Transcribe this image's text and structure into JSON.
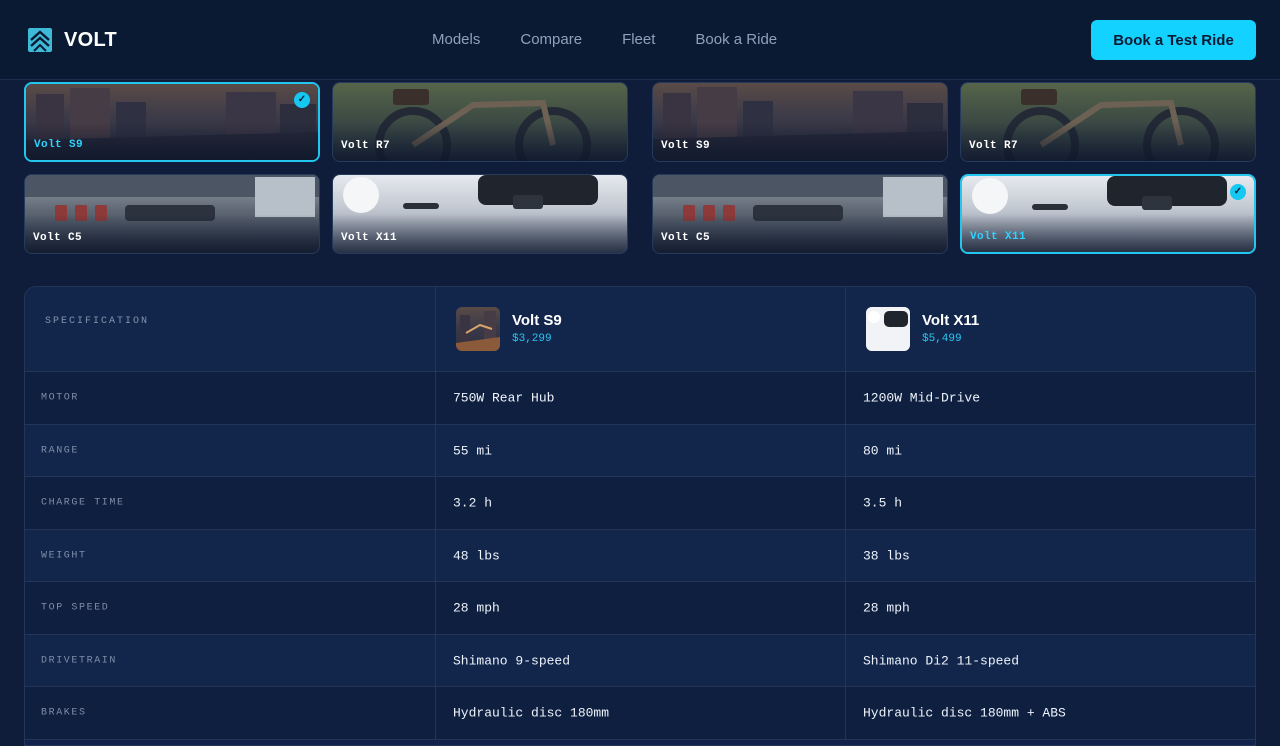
{
  "brand": {
    "name": "VOLT",
    "logo_icon": "chevron-up-logo-icon"
  },
  "nav": {
    "items": [
      "Models",
      "Compare",
      "Fleet",
      "Book a Ride"
    ]
  },
  "cta": {
    "label": "Book a Test Ride"
  },
  "colors": {
    "accent": "#14d2ff",
    "background": "#0f1d3a",
    "header": "#0b1a33"
  },
  "selector_groups": [
    {
      "thumbs": [
        {
          "label": "Volt S9",
          "art": "city",
          "selected": true
        },
        {
          "label": "Volt R7",
          "art": "bike",
          "selected": false
        },
        {
          "label": "Volt C5",
          "art": "dash",
          "selected": false
        },
        {
          "label": "Volt X11",
          "art": "snow",
          "selected": false
        }
      ]
    },
    {
      "thumbs": [
        {
          "label": "Volt S9",
          "art": "city",
          "selected": false
        },
        {
          "label": "Volt R7",
          "art": "bike",
          "selected": false
        },
        {
          "label": "Volt C5",
          "art": "dash",
          "selected": false
        },
        {
          "label": "Volt X11",
          "art": "snow",
          "selected": true
        }
      ]
    }
  ],
  "comparison": {
    "header_label": "SPECIFICATION",
    "models": [
      {
        "name": "Volt S9",
        "price": "$3,299",
        "art": "city"
      },
      {
        "name": "Volt X11",
        "price": "$5,499",
        "art": "snow"
      }
    ],
    "rows": [
      {
        "spec": "MOTOR",
        "values": [
          "750W Rear Hub",
          "1200W Mid-Drive"
        ]
      },
      {
        "spec": "RANGE",
        "values": [
          "55 mi",
          "80 mi"
        ]
      },
      {
        "spec": "CHARGE TIME",
        "values": [
          "3.2 h",
          "3.5 h"
        ]
      },
      {
        "spec": "WEIGHT",
        "values": [
          "48 lbs",
          "38 lbs"
        ]
      },
      {
        "spec": "TOP SPEED",
        "values": [
          "28 mph",
          "28 mph"
        ]
      },
      {
        "spec": "DRIVETRAIN",
        "values": [
          "Shimano 9-speed",
          "Shimano Di2 11-speed"
        ]
      },
      {
        "spec": "BRAKES",
        "values": [
          "Hydraulic disc 180mm",
          "Hydraulic disc 180mm + ABS"
        ]
      }
    ]
  }
}
